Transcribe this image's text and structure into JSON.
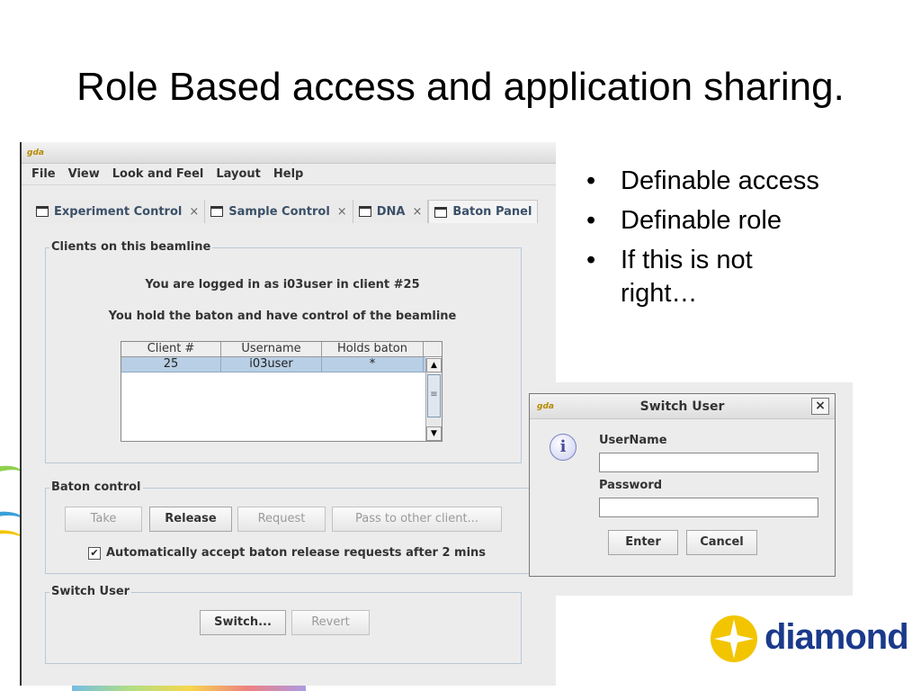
{
  "slide": {
    "title": "Role Based access and application sharing."
  },
  "app": {
    "icon": "gda-icon",
    "icon_text": "gda",
    "menu": [
      {
        "label": "File"
      },
      {
        "label": "View"
      },
      {
        "label": "Look and Feel"
      },
      {
        "label": "Layout"
      },
      {
        "label": "Help"
      }
    ],
    "tabs": [
      {
        "label": "Experiment Control",
        "close": "×"
      },
      {
        "label": "Sample Control",
        "close": "×"
      },
      {
        "label": "DNA",
        "close": "×"
      },
      {
        "label": "Baton Panel",
        "active": true
      }
    ],
    "clients_group": {
      "label": "Clients on this beamline",
      "login_text": "You are logged in as i03user in client #25",
      "baton_text": "You hold the baton and have control of the beamline",
      "columns": [
        "Client #",
        "Username",
        "Holds baton"
      ],
      "rows": [
        {
          "client": "25",
          "username": "i03user",
          "holds_baton": "*"
        }
      ]
    },
    "baton_group": {
      "label": "Baton control",
      "take_label": "Take",
      "release_label": "Release",
      "request_label": "Request",
      "pass_label": "Pass to other client...",
      "auto_accept_label": "Automatically accept baton release requests after 2 mins",
      "auto_accept_checked": true
    },
    "switch_group": {
      "label": "Switch User",
      "switch_label": "Switch...",
      "revert_label": "Revert"
    }
  },
  "bullets": [
    "Definable access",
    "Definable role",
    "If this is not right…"
  ],
  "dialog": {
    "icon_text": "gda",
    "title": "Switch User",
    "close": "×",
    "info_glyph": "i",
    "username_label": "UserName",
    "username_value": "",
    "password_label": "Password",
    "password_value": "",
    "enter_label": "Enter",
    "cancel_label": "Cancel"
  },
  "logo": {
    "text": "diamond",
    "colors": {
      "sun": "#f2c500",
      "text": "#1b3a8c"
    }
  }
}
